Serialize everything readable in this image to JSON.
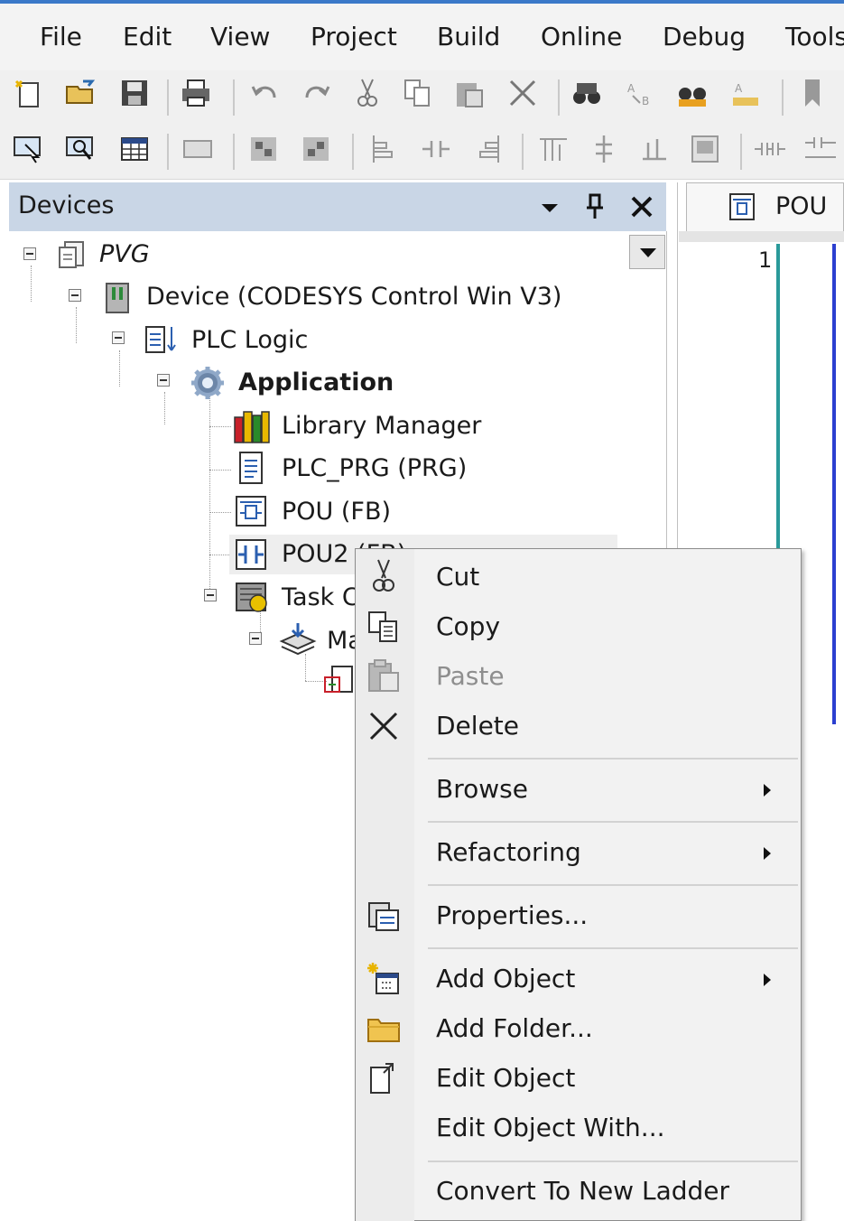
{
  "menubar": {
    "items": [
      "File",
      "Edit",
      "View",
      "Project",
      "Build",
      "Online",
      "Debug",
      "Tools"
    ]
  },
  "devices_panel": {
    "title": "Devices",
    "tree": [
      {
        "label": "PVG",
        "icon": "project-icon"
      },
      {
        "label": "Device (CODESYS Control Win V3)",
        "icon": "device-icon"
      },
      {
        "label": "PLC Logic",
        "icon": "plc-logic-icon"
      },
      {
        "label": "Application",
        "icon": "application-gear-icon"
      },
      {
        "label": "Library Manager",
        "icon": "library-books-icon"
      },
      {
        "label": "PLC_PRG (PRG)",
        "icon": "program-document-icon"
      },
      {
        "label": "POU (FB)",
        "icon": "function-block-icon"
      },
      {
        "label": "POU2 (FB)",
        "icon": "ladder-pou-icon"
      },
      {
        "label": "Task C",
        "icon": "task-config-icon"
      },
      {
        "label": "Ma",
        "icon": "task-stack-icon"
      },
      {
        "label": "",
        "icon": "task-call-icon"
      }
    ]
  },
  "editor": {
    "tab_label": "POU",
    "line_number": "1"
  },
  "context_menu": {
    "items": [
      {
        "label": "Cut",
        "icon": "scissors-icon"
      },
      {
        "label": "Copy",
        "icon": "copy-icon"
      },
      {
        "label": "Paste",
        "icon": "paste-icon",
        "disabled": true
      },
      {
        "label": "Delete",
        "icon": "delete-x-icon"
      },
      {
        "label": "Browse",
        "submenu": true
      },
      {
        "label": "Refactoring",
        "submenu": true
      },
      {
        "label": "Properties...",
        "icon": "properties-icon"
      },
      {
        "label": "Add Object",
        "icon": "add-object-icon",
        "submenu": true
      },
      {
        "label": "Add Folder...",
        "icon": "folder-icon"
      },
      {
        "label": "Edit Object",
        "icon": "edit-object-icon"
      },
      {
        "label": "Edit Object With..."
      },
      {
        "label": "Convert To New Ladder"
      }
    ]
  },
  "colors": {
    "accent": "#3a78c8",
    "panel_header": "#c9d6e6",
    "menu_bg": "#f2f2f2"
  }
}
